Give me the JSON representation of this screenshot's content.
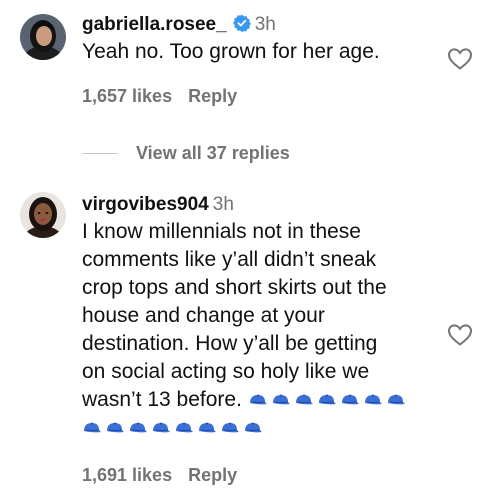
{
  "comments": [
    {
      "username": "gabriella.rosee_",
      "time": "3h",
      "verified": true,
      "text": "Yeah no. Too grown for her age.",
      "likes": "1,657 likes",
      "reply": "Reply"
    },
    {
      "username": "virgovibes904",
      "time": "3h",
      "verified": false,
      "text_lines": [
        "I know millennials not in these",
        "comments like y’all didn’t sneak",
        "crop tops and short skirts out the",
        "house and change at your",
        "destination. How y’all be getting",
        "on social acting so holy like we",
        "wasn’t 13 before."
      ],
      "emoji_name": "blue-cap-emoji",
      "likes": "1,691 likes",
      "reply": "Reply"
    }
  ],
  "view_replies": "View all 37 replies",
  "colors": {
    "secondary_text": "#737373",
    "verified_blue": "#3897f0",
    "cap_blue": "#3b6fd6"
  }
}
